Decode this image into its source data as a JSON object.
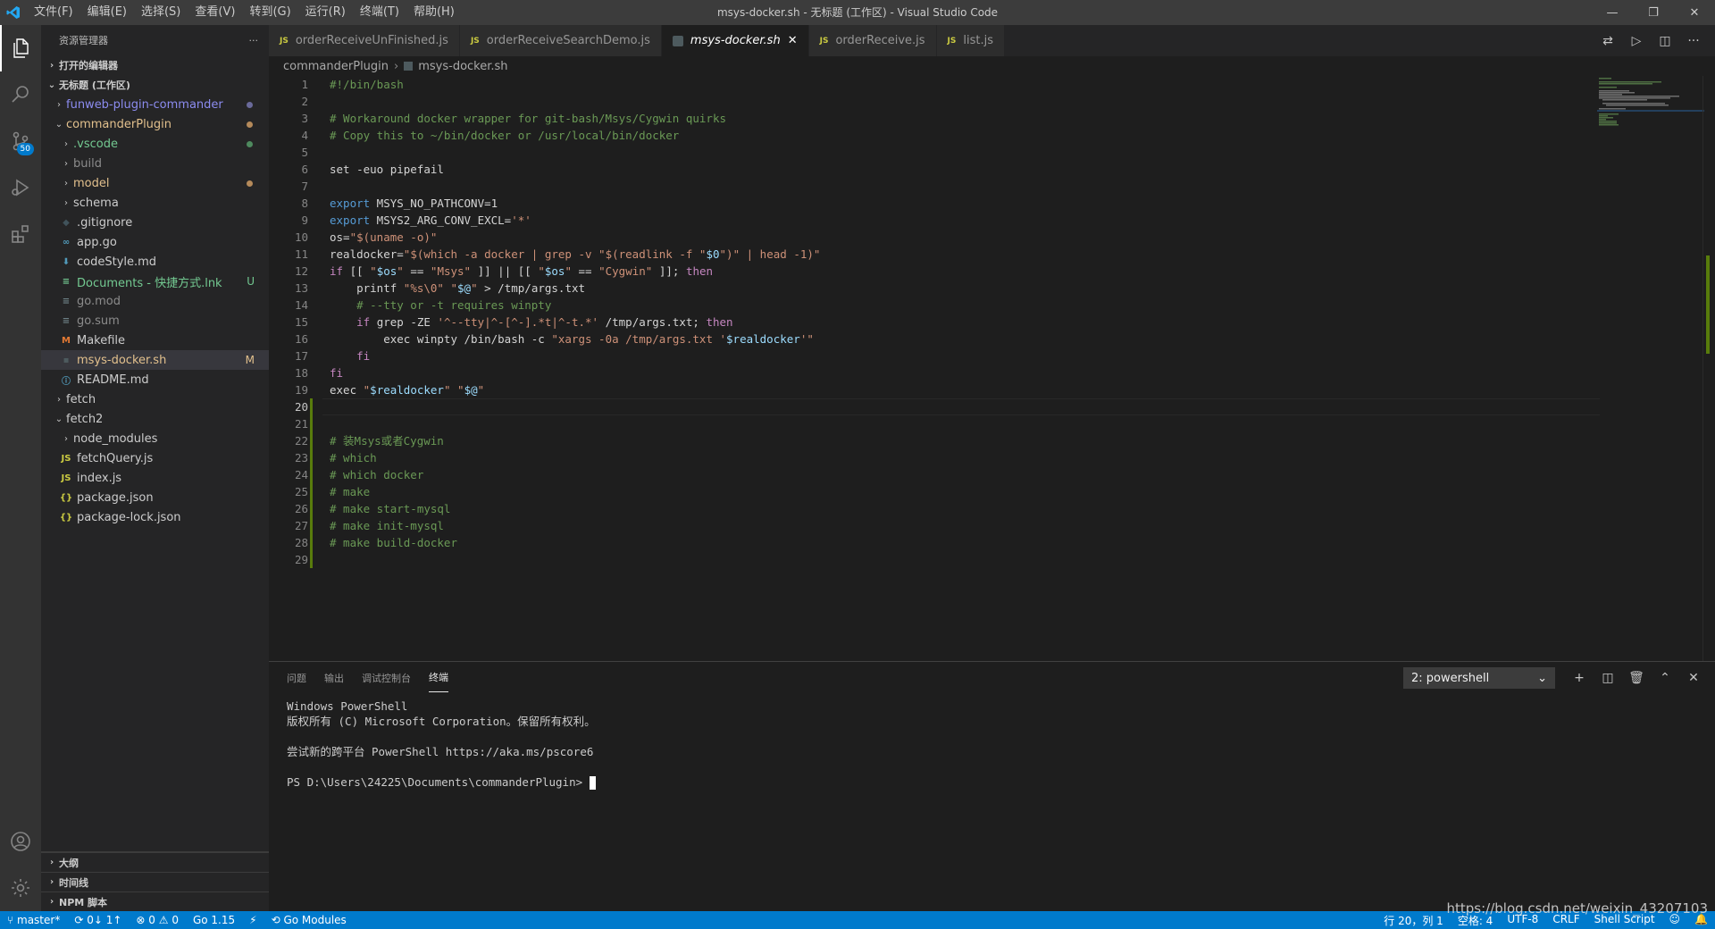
{
  "titlebar": {
    "menu": [
      "文件(F)",
      "编辑(E)",
      "选择(S)",
      "查看(V)",
      "转到(G)",
      "运行(R)",
      "终端(T)",
      "帮助(H)"
    ],
    "title": "msys-docker.sh - 无标题 (工作区) - Visual Studio Code"
  },
  "activity": {
    "scm_badge": "50"
  },
  "sidebar": {
    "header": "资源管理器",
    "open_editors": "打开的编辑器",
    "workspace": "无标题 (工作区)",
    "tree": [
      {
        "label": "funweb-plugin-commander",
        "indent": 0,
        "chev": "›",
        "color": "#8c8cf0",
        "mark": "dot",
        "markColor": "#6a6a9a"
      },
      {
        "label": "commanderPlugin",
        "indent": 0,
        "chev": "⌄",
        "color": "#e2c08d",
        "mark": "dot",
        "markColor": "#b58a5a"
      },
      {
        "label": ".vscode",
        "indent": 1,
        "chev": "›",
        "color": "#73c991",
        "mark": "dot",
        "markColor": "#4e8a5e"
      },
      {
        "label": "build",
        "indent": 1,
        "chev": "›",
        "color": "#8c8c8c"
      },
      {
        "label": "model",
        "indent": 1,
        "chev": "›",
        "color": "#e2c08d",
        "mark": "dot",
        "markColor": "#b58a5a"
      },
      {
        "label": "schema",
        "indent": 1,
        "chev": "›",
        "color": "#cccccc"
      },
      {
        "label": ".gitignore",
        "indent": 1,
        "icon": "◆",
        "iconColor": "#41535b",
        "color": "#cccccc"
      },
      {
        "label": "app.go",
        "indent": 1,
        "icon": "∞",
        "iconColor": "#519aba",
        "color": "#cccccc"
      },
      {
        "label": "codeStyle.md",
        "indent": 1,
        "icon": "⬇",
        "iconColor": "#519aba",
        "color": "#cccccc"
      },
      {
        "label": "Documents - 快捷方式.lnk",
        "indent": 1,
        "icon": "≡",
        "iconColor": "#73c991",
        "color": "#73c991",
        "mark": "text",
        "markText": "U",
        "markColor": "#73c991"
      },
      {
        "label": "go.mod",
        "indent": 1,
        "icon": "≡",
        "iconColor": "#6d8086",
        "color": "#8c8c8c"
      },
      {
        "label": "go.sum",
        "indent": 1,
        "icon": "≡",
        "iconColor": "#6d8086",
        "color": "#8c8c8c"
      },
      {
        "label": "Makefile",
        "indent": 1,
        "icon": "M",
        "iconColor": "#e37933",
        "color": "#cccccc"
      },
      {
        "label": "msys-docker.sh",
        "indent": 1,
        "icon": "▪",
        "iconColor": "#4d5a5e",
        "color": "#e2c08d",
        "mark": "text",
        "markText": "M",
        "markColor": "#e2c08d",
        "selected": true
      },
      {
        "label": "README.md",
        "indent": 1,
        "icon": "ⓘ",
        "iconColor": "#519aba",
        "color": "#cccccc"
      },
      {
        "label": "fetch",
        "indent": 0,
        "chev": "›",
        "color": "#cccccc"
      },
      {
        "label": "fetch2",
        "indent": 0,
        "chev": "⌄",
        "color": "#cccccc"
      },
      {
        "label": "node_modules",
        "indent": 1,
        "chev": "›",
        "color": "#cccccc"
      },
      {
        "label": "fetchQuery.js",
        "indent": 1,
        "icon": "JS",
        "iconColor": "#cbcb41",
        "color": "#cccccc"
      },
      {
        "label": "index.js",
        "indent": 1,
        "icon": "JS",
        "iconColor": "#cbcb41",
        "color": "#cccccc"
      },
      {
        "label": "package.json",
        "indent": 1,
        "icon": "{}",
        "iconColor": "#cbcb41",
        "color": "#cccccc"
      },
      {
        "label": "package-lock.json",
        "indent": 1,
        "icon": "{}",
        "iconColor": "#cbcb41",
        "color": "#cccccc"
      }
    ],
    "bottom_sections": [
      "大纲",
      "时间线",
      "NPM 脚本"
    ]
  },
  "tabs": [
    {
      "label": "orderReceiveUnFinished.js",
      "type": "js",
      "active": false
    },
    {
      "label": "orderReceiveSearchDemo.js",
      "type": "js",
      "active": false
    },
    {
      "label": "msys-docker.sh",
      "type": "sh",
      "active": true
    },
    {
      "label": "orderReceive.js",
      "type": "js",
      "active": false
    },
    {
      "label": "list.js",
      "type": "js",
      "active": false
    }
  ],
  "breadcrumb": [
    "commanderPlugin",
    "msys-docker.sh"
  ],
  "code": {
    "current_line": 20,
    "lines": [
      [
        [
          "c-com",
          "#!/bin/bash"
        ]
      ],
      [],
      [
        [
          "c-com",
          "# Workaround docker wrapper for git-bash/Msys/Cygwin quirks"
        ]
      ],
      [
        [
          "c-com",
          "# Copy this to ~/bin/docker or /usr/local/bin/docker"
        ]
      ],
      [],
      [
        [
          "",
          "set -euo pipefail"
        ]
      ],
      [],
      [
        [
          "c-exp",
          "export"
        ],
        [
          "",
          " MSYS_NO_PATHCONV=1"
        ]
      ],
      [
        [
          "c-exp",
          "export"
        ],
        [
          "",
          " MSYS2_ARG_CONV_EXCL="
        ],
        [
          "c-str",
          "'*'"
        ]
      ],
      [
        [
          "",
          "os="
        ],
        [
          "c-str",
          "\"$(uname -o)\""
        ]
      ],
      [
        [
          "",
          "realdocker="
        ],
        [
          "c-str",
          "\"$(which -a docker | grep -v \""
        ],
        [
          "c-str",
          "$(readlink -f \""
        ],
        [
          "c-var",
          "$0"
        ],
        [
          "c-str",
          "\")\" | head -1)\""
        ]
      ],
      [
        [
          "c-kw",
          "if"
        ],
        [
          "",
          " [[ "
        ],
        [
          "c-str",
          "\""
        ],
        [
          "c-var",
          "$os"
        ],
        [
          "c-str",
          "\""
        ],
        [
          "",
          " == "
        ],
        [
          "c-str",
          "\"Msys\""
        ],
        [
          "",
          " ]] || [[ "
        ],
        [
          "c-str",
          "\""
        ],
        [
          "c-var",
          "$os"
        ],
        [
          "c-str",
          "\""
        ],
        [
          "",
          " == "
        ],
        [
          "c-str",
          "\"Cygwin\""
        ],
        [
          "",
          " ]]; "
        ],
        [
          "c-kw",
          "then"
        ]
      ],
      [
        [
          "",
          "    printf "
        ],
        [
          "c-str",
          "\"%s\\0\""
        ],
        [
          "",
          " "
        ],
        [
          "c-str",
          "\""
        ],
        [
          "c-var",
          "$@"
        ],
        [
          "c-str",
          "\""
        ],
        [
          "",
          " > /tmp/args.txt"
        ]
      ],
      [
        [
          "c-com",
          "    # --tty or -t requires winpty"
        ]
      ],
      [
        [
          "",
          "    "
        ],
        [
          "c-kw",
          "if"
        ],
        [
          "",
          " grep -ZE "
        ],
        [
          "c-str",
          "'^--tty|^-[^-].*t|^-t.*'"
        ],
        [
          "",
          " /tmp/args.txt; "
        ],
        [
          "c-kw",
          "then"
        ]
      ],
      [
        [
          "",
          "        exec winpty /bin/bash -c "
        ],
        [
          "c-str",
          "\"xargs -0a /tmp/args.txt '"
        ],
        [
          "c-var",
          "$realdocker"
        ],
        [
          "c-str",
          "'\""
        ]
      ],
      [
        [
          "",
          "    "
        ],
        [
          "c-kw",
          "fi"
        ]
      ],
      [
        [
          "c-kw",
          "fi"
        ]
      ],
      [
        [
          "",
          "exec "
        ],
        [
          "c-str",
          "\""
        ],
        [
          "c-var",
          "$realdocker"
        ],
        [
          "c-str",
          "\""
        ],
        [
          "",
          " "
        ],
        [
          "c-str",
          "\""
        ],
        [
          "c-var",
          "$@"
        ],
        [
          "c-str",
          "\""
        ]
      ],
      [],
      [],
      [
        [
          "c-com",
          "# 装Msys或者Cygwin"
        ]
      ],
      [
        [
          "c-com",
          "# which"
        ]
      ],
      [
        [
          "c-com",
          "# which docker"
        ]
      ],
      [
        [
          "c-com",
          "# make"
        ]
      ],
      [
        [
          "c-com",
          "# make start-mysql"
        ]
      ],
      [
        [
          "c-com",
          "# make init-mysql"
        ]
      ],
      [
        [
          "c-com",
          "# make build-docker"
        ]
      ],
      []
    ]
  },
  "panel": {
    "tabs": [
      "问题",
      "输出",
      "调试控制台",
      "终端"
    ],
    "active_tab": 3,
    "terminal_select": "2: powershell",
    "terminal_lines": [
      "Windows PowerShell",
      "版权所有 (C) Microsoft Corporation。保留所有权利。",
      "",
      "尝试新的跨平台 PowerShell https://aka.ms/pscore6",
      "",
      "PS D:\\Users\\24225\\Documents\\commanderPlugin> "
    ]
  },
  "statusbar": {
    "branch": "master*",
    "sync": "0↓ 1↑",
    "problems": "⊗ 0 ⚠ 0",
    "go_version": "Go 1.15",
    "go_modules": "Go Modules",
    "position": "行 20，列 1",
    "spaces": "空格: 4",
    "encoding": "UTF-8",
    "eol": "CRLF",
    "language": "Shell Script"
  },
  "watermark": "https://blog.csdn.net/weixin_43207103",
  "colors": {
    "accent": "#007acc",
    "git_added": "#587c0c"
  }
}
